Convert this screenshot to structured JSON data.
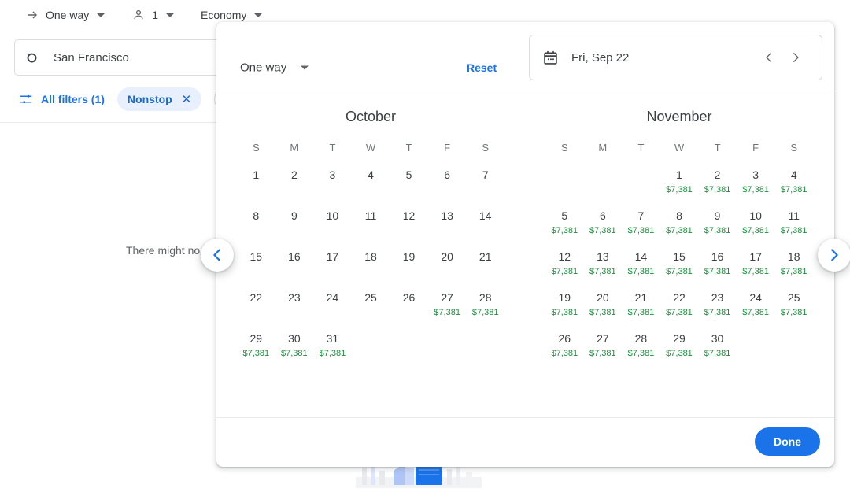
{
  "background": {
    "toolbar": {
      "trip_type": "One way",
      "trip_icon": "arrow-right-icon",
      "passengers": "1",
      "passenger_icon": "person-icon",
      "cabin_class": "Economy"
    },
    "search": {
      "origin_icon": "circle-outline-icon",
      "origin": "San Francisco"
    },
    "filters": {
      "all_filters_icon": "tune-icon",
      "all_filters_label": "All filters (1)",
      "nonstop_chip": "Nonstop",
      "nonstop_remove_icon": "close-icon"
    },
    "message": "There might no"
  },
  "popup": {
    "trip_type": "One way",
    "trip_type_icon": "chevron-down-icon",
    "reset_label": "Reset",
    "date_field": {
      "icon": "calendar-icon",
      "value": "Fri, Sep 22",
      "prev_icon": "chevron-left-icon",
      "next_icon": "chevron-right-icon"
    },
    "done_label": "Done",
    "prev_month_icon": "chevron-left-circle-icon",
    "next_month_icon": "chevron-right-circle-icon",
    "accent_color": "#1a73e8",
    "price_color": "#1e8e3e",
    "weekday_headers": [
      "S",
      "M",
      "T",
      "W",
      "T",
      "F",
      "S"
    ],
    "months": [
      {
        "name": "October",
        "lead_blanks": 0,
        "days": [
          {
            "n": "1",
            "price": ""
          },
          {
            "n": "2",
            "price": ""
          },
          {
            "n": "3",
            "price": ""
          },
          {
            "n": "4",
            "price": ""
          },
          {
            "n": "5",
            "price": ""
          },
          {
            "n": "6",
            "price": ""
          },
          {
            "n": "7",
            "price": ""
          },
          {
            "n": "8",
            "price": ""
          },
          {
            "n": "9",
            "price": ""
          },
          {
            "n": "10",
            "price": ""
          },
          {
            "n": "11",
            "price": ""
          },
          {
            "n": "12",
            "price": ""
          },
          {
            "n": "13",
            "price": ""
          },
          {
            "n": "14",
            "price": ""
          },
          {
            "n": "15",
            "price": ""
          },
          {
            "n": "16",
            "price": ""
          },
          {
            "n": "17",
            "price": ""
          },
          {
            "n": "18",
            "price": ""
          },
          {
            "n": "19",
            "price": ""
          },
          {
            "n": "20",
            "price": ""
          },
          {
            "n": "21",
            "price": ""
          },
          {
            "n": "22",
            "price": ""
          },
          {
            "n": "23",
            "price": ""
          },
          {
            "n": "24",
            "price": ""
          },
          {
            "n": "25",
            "price": ""
          },
          {
            "n": "26",
            "price": ""
          },
          {
            "n": "27",
            "price": "$7,381"
          },
          {
            "n": "28",
            "price": "$7,381"
          },
          {
            "n": "29",
            "price": "$7,381"
          },
          {
            "n": "30",
            "price": "$7,381"
          },
          {
            "n": "31",
            "price": "$7,381"
          }
        ]
      },
      {
        "name": "November",
        "lead_blanks": 3,
        "days": [
          {
            "n": "1",
            "price": "$7,381"
          },
          {
            "n": "2",
            "price": "$7,381"
          },
          {
            "n": "3",
            "price": "$7,381"
          },
          {
            "n": "4",
            "price": "$7,381"
          },
          {
            "n": "5",
            "price": "$7,381"
          },
          {
            "n": "6",
            "price": "$7,381"
          },
          {
            "n": "7",
            "price": "$7,381"
          },
          {
            "n": "8",
            "price": "$7,381"
          },
          {
            "n": "9",
            "price": "$7,381"
          },
          {
            "n": "10",
            "price": "$7,381"
          },
          {
            "n": "11",
            "price": "$7,381"
          },
          {
            "n": "12",
            "price": "$7,381"
          },
          {
            "n": "13",
            "price": "$7,381"
          },
          {
            "n": "14",
            "price": "$7,381"
          },
          {
            "n": "15",
            "price": "$7,381"
          },
          {
            "n": "16",
            "price": "$7,381"
          },
          {
            "n": "17",
            "price": "$7,381"
          },
          {
            "n": "18",
            "price": "$7,381"
          },
          {
            "n": "19",
            "price": "$7,381"
          },
          {
            "n": "20",
            "price": "$7,381"
          },
          {
            "n": "21",
            "price": "$7,381"
          },
          {
            "n": "22",
            "price": "$7,381"
          },
          {
            "n": "23",
            "price": "$7,381"
          },
          {
            "n": "24",
            "price": "$7,381"
          },
          {
            "n": "25",
            "price": "$7,381"
          },
          {
            "n": "26",
            "price": "$7,381"
          },
          {
            "n": "27",
            "price": "$7,381"
          },
          {
            "n": "28",
            "price": "$7,381"
          },
          {
            "n": "29",
            "price": "$7,381"
          },
          {
            "n": "30",
            "price": "$7,381"
          }
        ]
      }
    ]
  }
}
